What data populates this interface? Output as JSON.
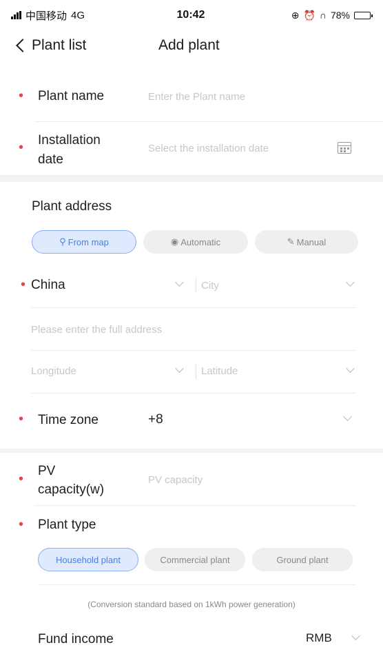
{
  "status_bar": {
    "carrier": "中国移动",
    "network": "4G",
    "time": "10:42",
    "battery": "78%",
    "battery_level": 0.78
  },
  "nav": {
    "back_label": "Plant list",
    "title": "Add plant"
  },
  "form": {
    "plant_name": {
      "label": "Plant name",
      "placeholder": "Enter the Plant name"
    },
    "installation_date": {
      "label_line1": "Installation",
      "label_line2": "date",
      "placeholder": "Select the installation date"
    },
    "plant_address": {
      "label": "Plant address",
      "modes": [
        "From map",
        "Automatic",
        "Manual"
      ],
      "selected_mode": "From map",
      "country": "China",
      "city_placeholder": "City",
      "full_address_placeholder": "Please enter the full address",
      "longitude_placeholder": "Longitude",
      "latitude_placeholder": "Latitude"
    },
    "time_zone": {
      "label": "Time zone",
      "value": "+8"
    },
    "pv_capacity": {
      "label_line1": "PV",
      "label_line2": "capacity(w)",
      "placeholder": "PV capacity"
    },
    "plant_type": {
      "label": "Plant type",
      "options": [
        "Household plant",
        "Commercial plant",
        "Ground plant"
      ],
      "selected": "Household plant"
    },
    "conversion_note": "(Conversion standard based on 1kWh power generation)",
    "fund_income": {
      "label": "Fund income",
      "currency": "RMB"
    }
  },
  "colors": {
    "required_marker": "#e0484f",
    "accent": "#4a7fe0"
  }
}
